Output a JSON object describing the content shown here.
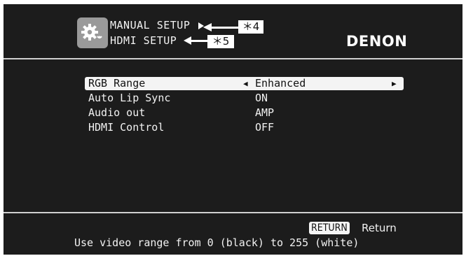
{
  "header": {
    "breadcrumb_parent": "MANUAL SETUP",
    "breadcrumb_current": "HDMI SETUP",
    "brand": "DENON",
    "callout_parent": "＊4",
    "callout_current": "＊5",
    "icon": "gear-icon"
  },
  "menu": {
    "items": [
      {
        "label": "RGB Range",
        "value": "Enhanced"
      },
      {
        "label": "Auto Lip Sync",
        "value": "ON"
      },
      {
        "label": "Audio out",
        "value": "AMP"
      },
      {
        "label": "HDMI Control",
        "value": "OFF"
      }
    ],
    "selected_index": 0
  },
  "footer": {
    "return_button": "RETURN",
    "return_label": "Return",
    "help": "Use video range from 0 (black) to 255 (white)"
  },
  "colors": {
    "background": "#1c1c1c",
    "text": "#f2f2f2",
    "highlight": "#f4f4f4"
  }
}
